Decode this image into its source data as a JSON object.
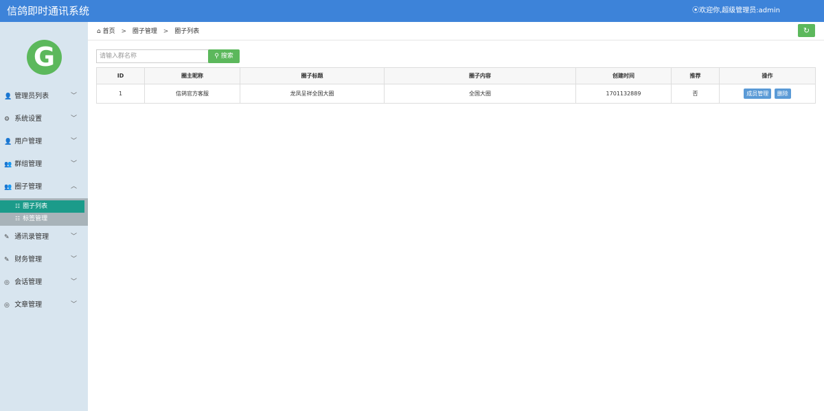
{
  "app": {
    "title": "信鸽即时通讯系统",
    "user_info": "⦿欢迎你,超级管理员:admin"
  },
  "logo": {
    "letter": "G",
    "color": "#5cb85c"
  },
  "sidebar": {
    "items": [
      {
        "icon": "user-icon",
        "glyph": "👤",
        "label": "管理员列表",
        "expanded": false
      },
      {
        "icon": "gear-icon",
        "glyph": "⚙",
        "label": "系统设置",
        "expanded": false
      },
      {
        "icon": "user-icon",
        "glyph": "👤",
        "label": "用户管理",
        "expanded": false
      },
      {
        "icon": "group-icon",
        "glyph": "👥",
        "label": "群组管理",
        "expanded": false
      },
      {
        "icon": "group-icon",
        "glyph": "👥",
        "label": "圈子管理",
        "expanded": true
      },
      {
        "icon": "edit-icon",
        "glyph": "✎",
        "label": "通讯录管理",
        "expanded": false
      },
      {
        "icon": "edit-icon",
        "glyph": "✎",
        "label": "财务管理",
        "expanded": false
      },
      {
        "icon": "chat-icon",
        "glyph": "◎",
        "label": "会话管理",
        "expanded": false
      },
      {
        "icon": "chat-icon",
        "glyph": "◎",
        "label": "文章管理",
        "expanded": false
      }
    ],
    "submenu": [
      {
        "label": "圈子列表",
        "active": true
      },
      {
        "label": "标签管理",
        "active": false
      }
    ]
  },
  "breadcrumb": {
    "home": "首页",
    "level1": "圈子管理",
    "level2": "圈子列表",
    "separator": ">"
  },
  "search": {
    "placeholder": "请输入群名称",
    "button_label": "搜索"
  },
  "table": {
    "headers": [
      "ID",
      "圈主昵称",
      "圈子标题",
      "圈子内容",
      "创建时间",
      "推荐",
      "操作"
    ],
    "rows": [
      {
        "id": "1",
        "owner": "信鸽官方客服",
        "title": "龙凤呈祥全国大圈",
        "content": "全国大圈",
        "created": "1701132889",
        "recommend": "否"
      }
    ],
    "actions": {
      "members": "成员管理",
      "delete": "删除"
    }
  },
  "colors": {
    "topbar": "#3d83d9",
    "sidebar": "#d8e5ef",
    "active_sub": "#1b9b8a",
    "green_button": "#5cb85c",
    "blue_button": "#5a9ad6"
  }
}
